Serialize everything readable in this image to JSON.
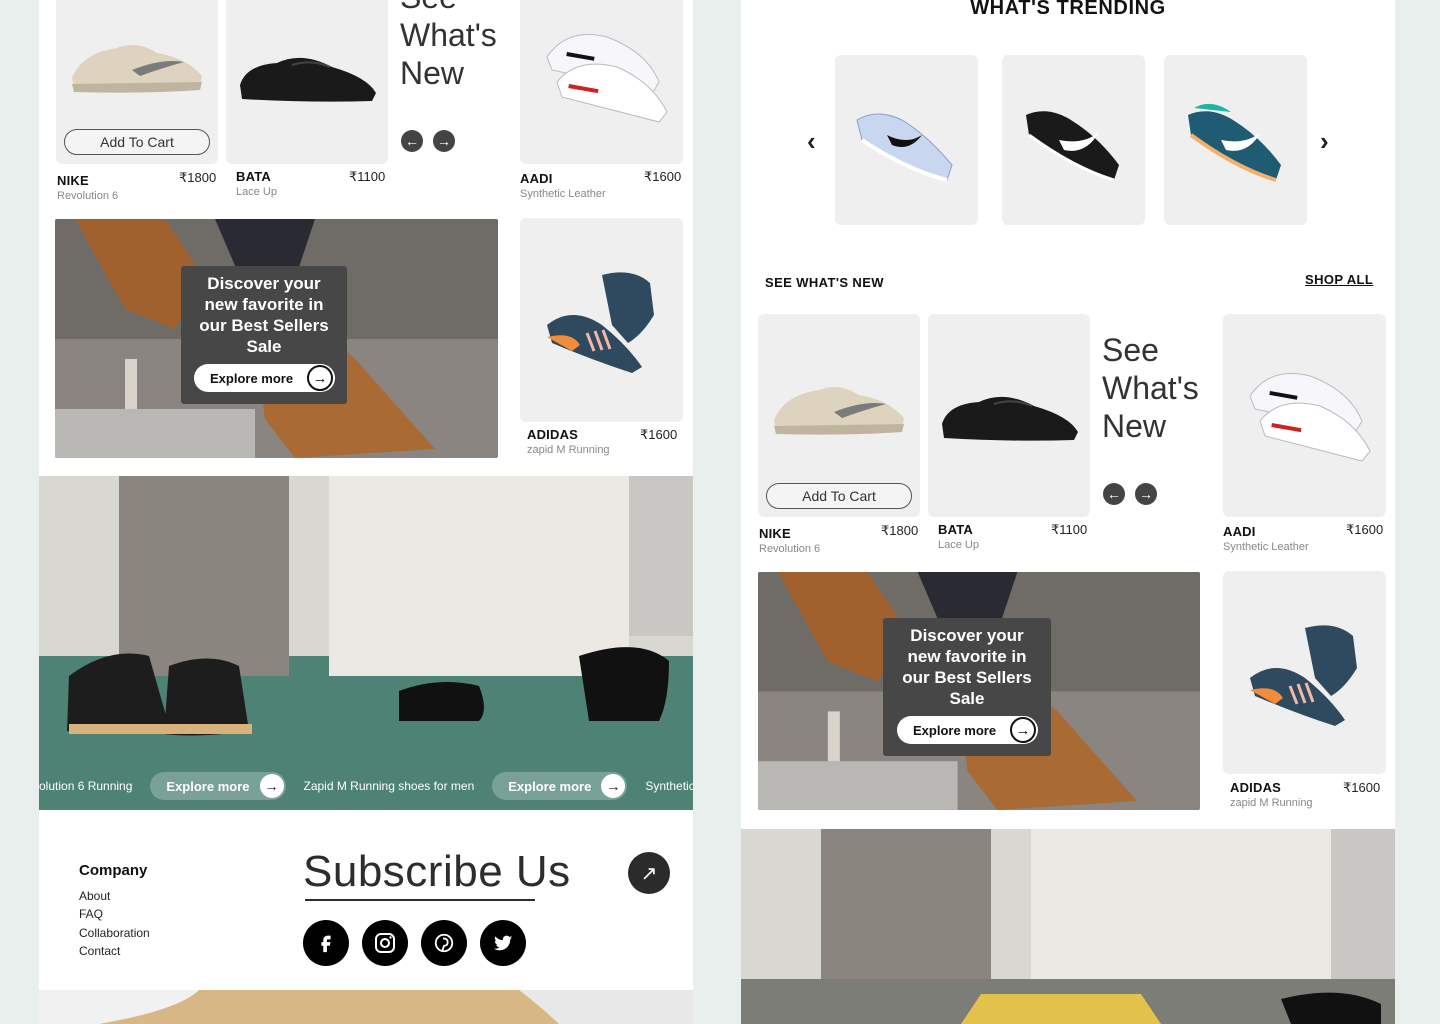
{
  "products": {
    "nike": {
      "brand": "NIKE",
      "model": "Revolution 6",
      "price": "₹1800",
      "add_to_cart": "Add To Cart"
    },
    "bata": {
      "brand": "BATA",
      "model": "Lace Up",
      "price": "₹1100"
    },
    "aadi": {
      "brand": "AADI",
      "model": "Synthetic Leather",
      "price": "₹1600"
    },
    "adidas": {
      "brand": "ADIDAS",
      "model": "zapid M Running",
      "price": "₹1600"
    }
  },
  "see_new": {
    "title_line1": "See",
    "title_line2": "What's",
    "title_line3": "New",
    "prev_icon": "←",
    "next_icon": "→"
  },
  "promo": {
    "text": "Discover your new favorite in our Best Sellers Sale",
    "cta": "Explore more",
    "arrow": "→"
  },
  "ticker": {
    "item1": "olution 6 Running",
    "cta1": "Explore more",
    "item2": "Zapid M Running shoes for men",
    "cta2": "Explore more",
    "item3": "Synthetic L"
  },
  "footer": {
    "company_title": "Company",
    "links": [
      "About",
      "FAQ",
      "Collaboration",
      "Contact"
    ],
    "subscribe": "Subscribe Us",
    "subscribe_icon": "↗",
    "social_icons": [
      "facebook-icon",
      "instagram-icon",
      "pinterest-icon",
      "twitter-icon"
    ]
  },
  "trending": {
    "title": "WHAT'S TRENDING",
    "prev": "‹",
    "next": "›"
  },
  "section": {
    "see_whats_new": "SEE WHAT'S NEW",
    "shop_all": "SHOP ALL"
  },
  "colors": {
    "page_bg": "#e9efed",
    "card_bg": "#efefef",
    "promo_bg": "#474747",
    "text_dark": "#111111"
  }
}
